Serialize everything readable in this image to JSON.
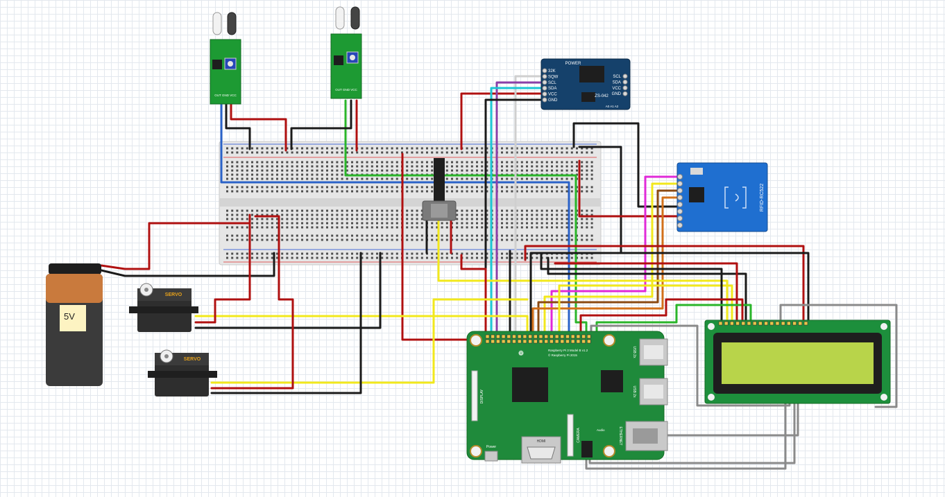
{
  "colors": {
    "board_green": "#1f8a3b",
    "module_green": "#1d9a33",
    "rtc_blue": "#15416b",
    "rfid_blue": "#1f6fd0",
    "lcd_screen": "#b8d44a",
    "battery_copper": "#c97a3d",
    "battery_black": "#3b3b3b",
    "servo_black": "#2e2e2e",
    "servo_label": "#e8a21a",
    "wire_red": "#b01010",
    "wire_black": "#1a1a1a",
    "wire_yellow": "#f2e81c",
    "wire_green": "#2ab52a",
    "wire_blue": "#2a62c8",
    "wire_cyan": "#1bc6d4",
    "wire_magenta": "#e02ad8",
    "wire_purple": "#8a3fa8",
    "wire_brown": "#8b4a12",
    "wire_orange": "#d2701a",
    "wire_gray": "#8a8a8a",
    "wire_white": "#cfcfcf"
  },
  "battery": {
    "label": "5V"
  },
  "servo1": {
    "label": "SERVO"
  },
  "servo2": {
    "label": "SERVO"
  },
  "ir1": {
    "pins_label": "OUT GND VCC"
  },
  "ir2": {
    "pins_label": "OUT GND VCC"
  },
  "rtc": {
    "power_label": "POWER",
    "chip_label": "ZS-042",
    "addr_label": "A0 A1 A2",
    "left_pins": [
      "32K",
      "SQW",
      "SCL",
      "SDA",
      "VCC",
      "GND"
    ],
    "right_pins": [
      "SCL",
      "SDA",
      "VCC",
      "GND"
    ]
  },
  "rfid": {
    "label": "RFID-RC522"
  },
  "pi": {
    "model_label": "Raspberry Pi 3 Model B v1.2",
    "copyright_label": "© Raspberry Pi 2015",
    "usb_label_1": "USB 2x",
    "usb_label_2": "USB 2x",
    "ethernet_label": "ETHERNET",
    "hdmi_label": "HDMI",
    "power_label": "Power",
    "display_label": "DISPLAY",
    "camera_label": "CAMERA",
    "audio_label": "Audio",
    "dsi_label": "DSI"
  }
}
